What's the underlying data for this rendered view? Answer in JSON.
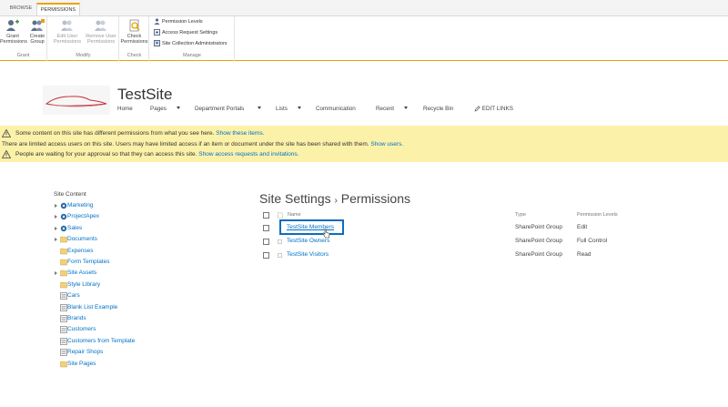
{
  "ribbon": {
    "tabs": [
      "BROWSE",
      "PERMISSIONS"
    ],
    "grant": {
      "label": "Grant",
      "buttons": [
        {
          "label": "Grant Permissions",
          "icon": "grant-permissions-icon"
        },
        {
          "label": "Create Group",
          "icon": "create-group-icon"
        }
      ]
    },
    "modify": {
      "label": "Modify",
      "buttons": [
        {
          "label": "Edit User Permissions",
          "icon": "edit-user-permissions-icon"
        },
        {
          "label": "Remove User Permissions",
          "icon": "remove-user-permissions-icon"
        }
      ]
    },
    "check": {
      "label": "Check",
      "buttons": [
        {
          "label": "Check Permissions",
          "icon": "check-permissions-icon"
        }
      ]
    },
    "manage": {
      "label": "Manage",
      "items": [
        "Permission Levels",
        "Access Request Settings",
        "Site Collection Administrators"
      ]
    }
  },
  "site": {
    "title": "TestSite",
    "nav": [
      "Home",
      "Pages",
      "Department Portals",
      "Lists",
      "Communication",
      "Recent",
      "Recycle Bin"
    ],
    "edit_links": "EDIT LINKS"
  },
  "banner": {
    "line1_text": "Some content on this site has different permissions from what you see here.",
    "line1_link": "Show these items.",
    "line2_text": "There are limited access users on this site. Users may have limited access if an item or document under the site has been shared with them.",
    "line2_link": "Show users.",
    "line3_text": "People are waiting for your approval so that they can access this site.",
    "line3_link": "Show access requests and invitations."
  },
  "sidebar": {
    "title": "Site Content",
    "items": [
      {
        "label": "Marketing",
        "icon": "subsite-icon",
        "expandable": true
      },
      {
        "label": "ProjectApex",
        "icon": "subsite-icon",
        "expandable": true
      },
      {
        "label": "Sales",
        "icon": "subsite-icon",
        "expandable": true
      },
      {
        "label": "Documents",
        "icon": "library-icon",
        "expandable": true
      },
      {
        "label": "Expenses",
        "icon": "library-icon",
        "expandable": false
      },
      {
        "label": "Form Templates",
        "icon": "library-icon",
        "expandable": false
      },
      {
        "label": "Site Assets",
        "icon": "library-icon",
        "expandable": true
      },
      {
        "label": "Style Library",
        "icon": "library-icon",
        "expandable": false
      },
      {
        "label": "Cars",
        "icon": "list-icon",
        "expandable": false
      },
      {
        "label": "Blank List Example",
        "icon": "list-icon",
        "expandable": false
      },
      {
        "label": "Brands",
        "icon": "list-icon",
        "expandable": false
      },
      {
        "label": "Customers",
        "icon": "list-icon",
        "expandable": false
      },
      {
        "label": "Customers from Template",
        "icon": "list-icon",
        "expandable": false
      },
      {
        "label": "Repair Shops",
        "icon": "list-icon",
        "expandable": false
      },
      {
        "label": "Site Pages",
        "icon": "library-icon",
        "expandable": false
      }
    ]
  },
  "main": {
    "breadcrumb_parent": "Site Settings",
    "breadcrumb_separator": "›",
    "breadcrumb_current": "Permissions",
    "columns": [
      "Name",
      "Type",
      "Permission Levels"
    ],
    "rows": [
      {
        "name": "TestSite Members",
        "type": "SharePoint Group",
        "level": "Edit"
      },
      {
        "name": "TestSite Owners",
        "type": "SharePoint Group",
        "level": "Full Control"
      },
      {
        "name": "TestSite Visitors",
        "type": "SharePoint Group",
        "level": "Read"
      }
    ]
  },
  "colors": {
    "accent": "#e8a400",
    "link": "#0072c6",
    "banner": "#fcf1a8",
    "selection": "#0f6cbd"
  }
}
